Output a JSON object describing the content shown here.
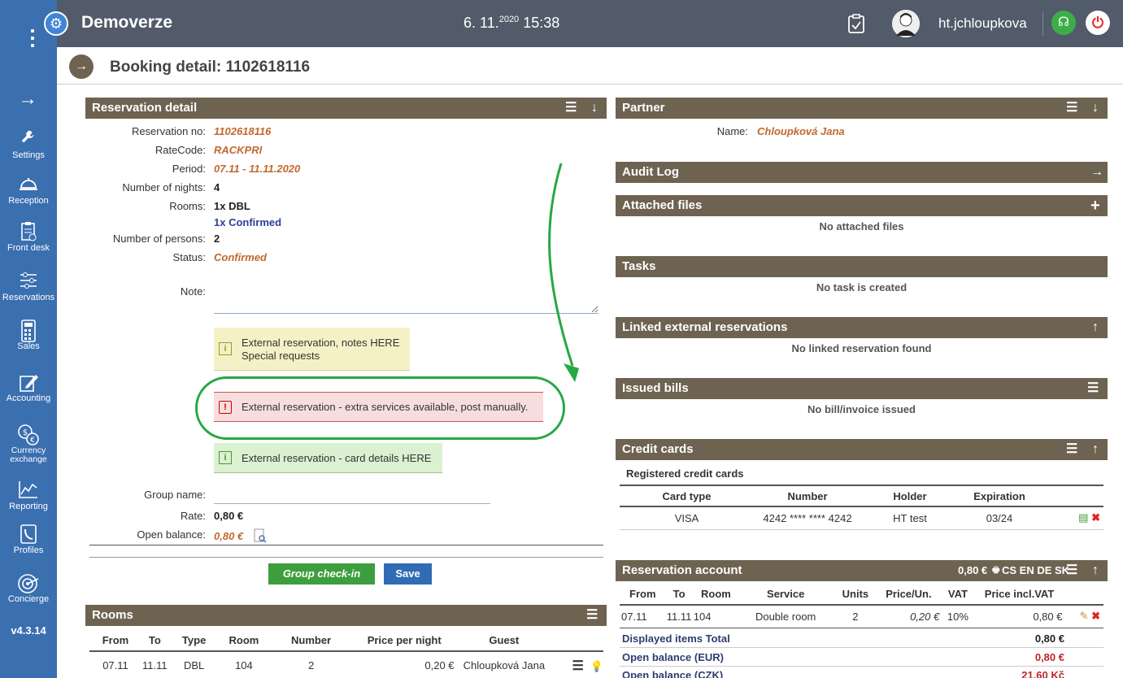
{
  "sidebar": {
    "dots": "⋮",
    "expand_icon": "→",
    "items": [
      {
        "label": "Settings",
        "icon": "wrench-icon",
        "glyph": "🔧"
      },
      {
        "label": "Reception",
        "icon": "bell-icon",
        "glyph": "🛎"
      },
      {
        "label": "Front desk",
        "icon": "clipboard-icon",
        "glyph": "📋"
      },
      {
        "label": "Reservations",
        "icon": "sliders-icon",
        "glyph": "☰"
      },
      {
        "label": "Sales",
        "icon": "calculator-icon",
        "glyph": "🖩"
      },
      {
        "label": "Accounting",
        "icon": "pen-icon",
        "glyph": "✎"
      },
      {
        "label": "Currency exchange",
        "icon": "currency-icon",
        "glyph": "$"
      },
      {
        "label": "Reporting",
        "icon": "chart-icon",
        "glyph": "📈"
      },
      {
        "label": "Profiles",
        "icon": "profile-icon",
        "glyph": "☏"
      },
      {
        "label": "Concierge",
        "icon": "target-icon",
        "glyph": "◎"
      }
    ],
    "version": "v4.3.14"
  },
  "topbar": {
    "app_title": "Demoverze",
    "date_main": "6. 11.",
    "date_year": "2020",
    "time": "15:38",
    "username": "ht.jchloupkova"
  },
  "page": {
    "title": "Booking detail: 1102618116"
  },
  "reservation_detail": {
    "header": "Reservation detail",
    "fields": {
      "reservation_no_label": "Reservation no:",
      "reservation_no": "1102618116",
      "ratecode_label": "RateCode:",
      "ratecode": "RACKPRI",
      "period_label": "Period:",
      "period": "07.11 - 11.11.2020",
      "nights_label": "Number of nights:",
      "nights": "4",
      "rooms_label": "Rooms:",
      "rooms": "1x DBL",
      "rooms_status": "1x Confirmed",
      "persons_label": "Number of persons:",
      "persons": "2",
      "status_label": "Status:",
      "status": "Confirmed",
      "note_label": "Note:",
      "group_name_label": "Group name:",
      "rate_label": "Rate:",
      "rate": "0,80 €",
      "open_balance_label": "Open balance:",
      "open_balance": "0,80 €"
    },
    "messages": {
      "yellow_line1": "External reservation, notes HERE",
      "yellow_line2": "Special requests",
      "red": "External reservation - extra services available, post manually.",
      "green": "External reservation - card details HERE"
    },
    "buttons": {
      "group_checkin": "Group check-in",
      "save": "Save"
    }
  },
  "rooms_panel": {
    "header": "Rooms",
    "columns": [
      "From",
      "To",
      "Type",
      "Room",
      "Number",
      "Price per night",
      "Guest"
    ],
    "rows": [
      {
        "from": "07.11",
        "to": "11.11",
        "type": "DBL",
        "room": "104",
        "number": "2",
        "price": "0,20 €",
        "guest": "Chloupková Jana"
      }
    ]
  },
  "partner": {
    "header": "Partner",
    "name_label": "Name:",
    "name": "Chloupková Jana"
  },
  "audit_log": {
    "header": "Audit Log"
  },
  "attached_files": {
    "header": "Attached files",
    "empty": "No attached files"
  },
  "tasks": {
    "header": "Tasks",
    "empty": "No task is created"
  },
  "linked_external": {
    "header": "Linked external reservations",
    "empty": "No linked reservation found"
  },
  "issued_bills": {
    "header": "Issued bills",
    "empty": "No bill/invoice issued"
  },
  "credit_cards": {
    "header": "Credit cards",
    "subheader": "Registered credit cards",
    "columns": [
      "Card type",
      "Number",
      "Holder",
      "Expiration"
    ],
    "rows": [
      {
        "type": "VISA",
        "number": "4242 **** **** 4242",
        "holder": "HT test",
        "expiration": "03/24"
      }
    ]
  },
  "reservation_account": {
    "header": "Reservation account",
    "header_amount": "0,80 €",
    "header_langs": "CS EN DE SK",
    "columns": [
      "From",
      "To",
      "Room",
      "Service",
      "Units",
      "Price/Un.",
      "VAT",
      "Price incl.VAT"
    ],
    "rows": [
      {
        "from": "07.11",
        "to": "11.11",
        "room": "104",
        "service": "Double room",
        "units": "2",
        "price_un": "0,20 €",
        "vat": "10%",
        "price_incl": "0,80 €"
      }
    ],
    "totals": [
      {
        "label": "Displayed items Total",
        "value": "0,80 €"
      },
      {
        "label": "Open balance (EUR)",
        "value": "0,80 €"
      },
      {
        "label": "Open balance (CZK)",
        "value": "21,60 Kč"
      }
    ]
  }
}
